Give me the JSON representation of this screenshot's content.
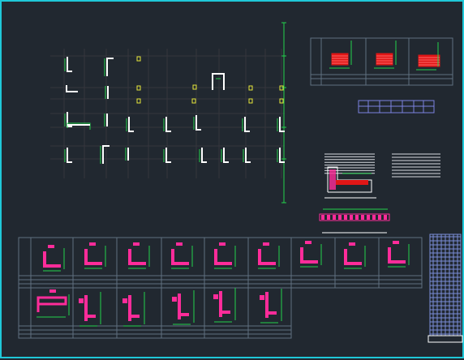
{
  "viewport": {
    "background": "#212830",
    "frame_color": "#1fc8d8"
  },
  "colors": {
    "column": "#ffffff",
    "rebar": "#ff2c9a",
    "rebar_dark": "#e01616",
    "dimension": "#22d24c",
    "annotation": "#e8e83a",
    "axis": "#35363d",
    "table": "#5f7080",
    "table_highlight": "#7c82e0",
    "text_lines": "#d7dae0",
    "mesh": "#7b8ed8"
  },
  "drawing": {
    "plan": {
      "name": "column-layout-plan",
      "column_count": 30,
      "axis_rows": 7,
      "axis_cols": 13
    },
    "section_table_top": {
      "name": "section-table-top",
      "cells": 3
    },
    "section_table_bottom": {
      "name": "section-table-bottom",
      "row1_cells": 9,
      "row2_cells": 6
    },
    "detail_group": {
      "name": "detail-group",
      "text_blocks": 2
    },
    "elevation": {
      "name": "column-elevation-detail"
    }
  }
}
